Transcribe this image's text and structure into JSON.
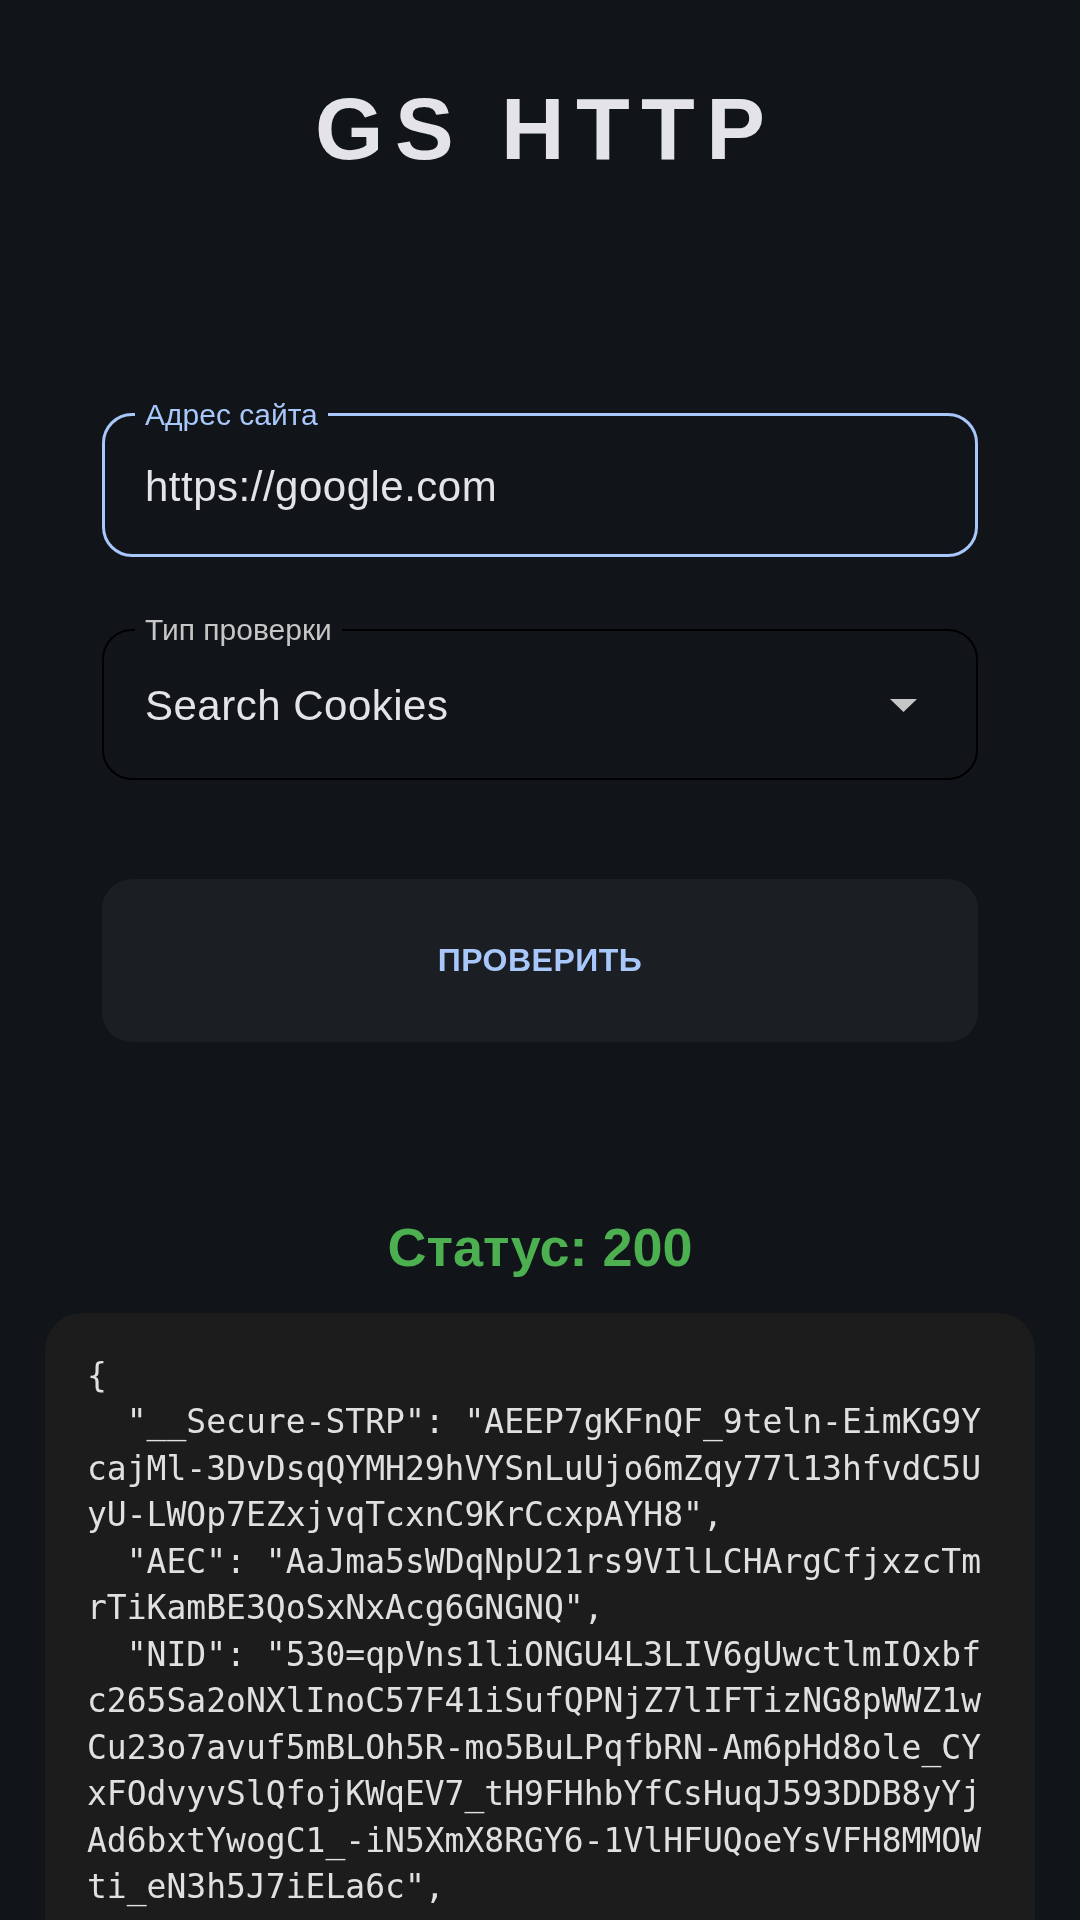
{
  "app_title": "GS HTTP",
  "form": {
    "fields": [
      {
        "kind": "text",
        "label": "Адрес сайта",
        "value": "https://google.com",
        "focused": true
      },
      {
        "kind": "select",
        "label": "Тип проверки",
        "value": "Search Cookies",
        "focused": false
      }
    ],
    "submit_button": "ПРОВЕРИТЬ"
  },
  "result": {
    "status": "Статус: 200",
    "body": "{\n  \"__Secure-STRP\": \"AEEP7gKFnQF_9teln-EimKG9YcajMl-3DvDsqQYMH29hVYSnLuUjo6mZqy77l13hfvdC5UyU-LWOp7EZxjvqTcxnC9KrCcxpAYH8\",\n  \"AEC\": \"AaJma5sWDqNpU21rs9VIlLCHArgCfjxzcTmrTiKamBE3QoSxNxAcg6GNGNQ\",\n  \"NID\": \"530=qpVns1liONGU4L3LIV6gUwctlmIOxbfc265Sa2oNXlInoC57F41iSufQPNjZ7lIFTizNG8pWWZ1wCu23o7avuf5mBLOh5R-mo5BuLPqfbRN-Am6pHd8ole_CYxFOdvyvSlQfojKWqEV7_tH9FHhbYfCsHuqJ593DDB8yYjAd6bxtYwogC1_-iN5XmX8RGY6-1VlHFUQoeYsVFH8MMOWti_eN3h5J7iELa6c\","
  }
}
